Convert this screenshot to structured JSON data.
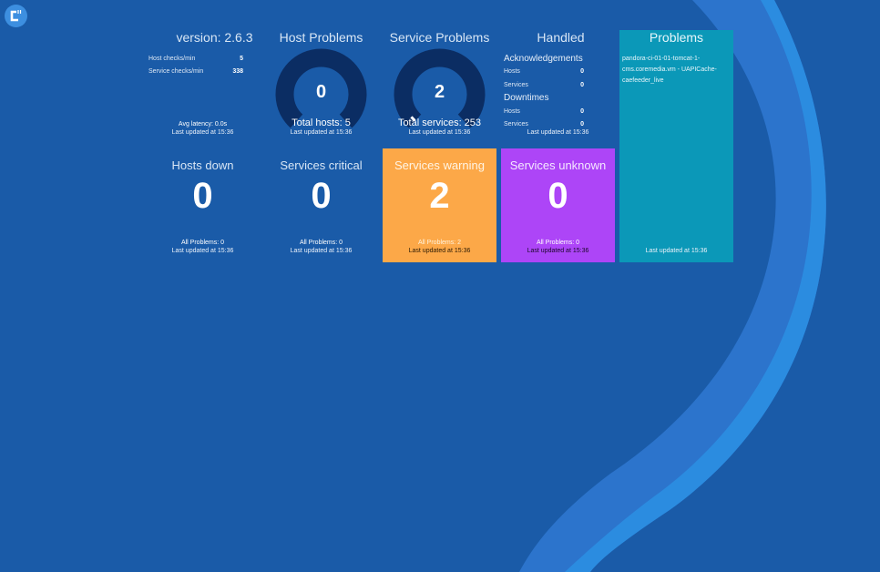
{
  "colors": {
    "bg": "#1a5ba8",
    "warning": "#fca848",
    "unknown": "#ad45f7",
    "problems": "#0b98b8",
    "gauge_track": "#0b2d63"
  },
  "version": {
    "title": "version: 2.6.3",
    "host_checks_label": "Host checks/min",
    "host_checks": "5",
    "service_checks_label": "Service checks/min",
    "service_checks": "338",
    "latency": "Avg latency: 0.0s",
    "updated": "Last updated at 15:36"
  },
  "host_problems": {
    "title": "Host Problems",
    "value": "0",
    "total": "Total hosts: 5",
    "updated": "Last updated at 15:36",
    "fraction": 0
  },
  "service_problems": {
    "title": "Service Problems",
    "value": "2",
    "total": "Total services: 253",
    "updated": "Last updated at 15:36",
    "fraction": 0.008
  },
  "handled": {
    "title": "Handled",
    "ack_label": "Acknowledgements",
    "ack_hosts_label": "Hosts",
    "ack_hosts": "0",
    "ack_services_label": "Services",
    "ack_services": "0",
    "down_label": "Downtimes",
    "down_hosts_label": "Hosts",
    "down_hosts": "0",
    "down_services_label": "Services",
    "down_services": "0",
    "updated": "Last updated at 15:36"
  },
  "problems": {
    "title": "Problems",
    "item": "pandora-ci-01-01-tomcat-1-cms.coremedia.vm - UAPICache-caefeeder_live",
    "updated": "Last updated at 15:36"
  },
  "hosts_down": {
    "title": "Hosts down",
    "value": "0",
    "all": "All Problems: 0",
    "updated": "Last updated at 15:36"
  },
  "services_critical": {
    "title": "Services critical",
    "value": "0",
    "all": "All Problems: 0",
    "updated": "Last updated at 15:36"
  },
  "services_warning": {
    "title": "Services warning",
    "value": "2",
    "all": "All Problems: 2",
    "updated": "Last updated at 15:36"
  },
  "services_unknown": {
    "title": "Services unknown",
    "value": "0",
    "all": "All Problems: 0",
    "updated": "Last updated at 15:36"
  }
}
